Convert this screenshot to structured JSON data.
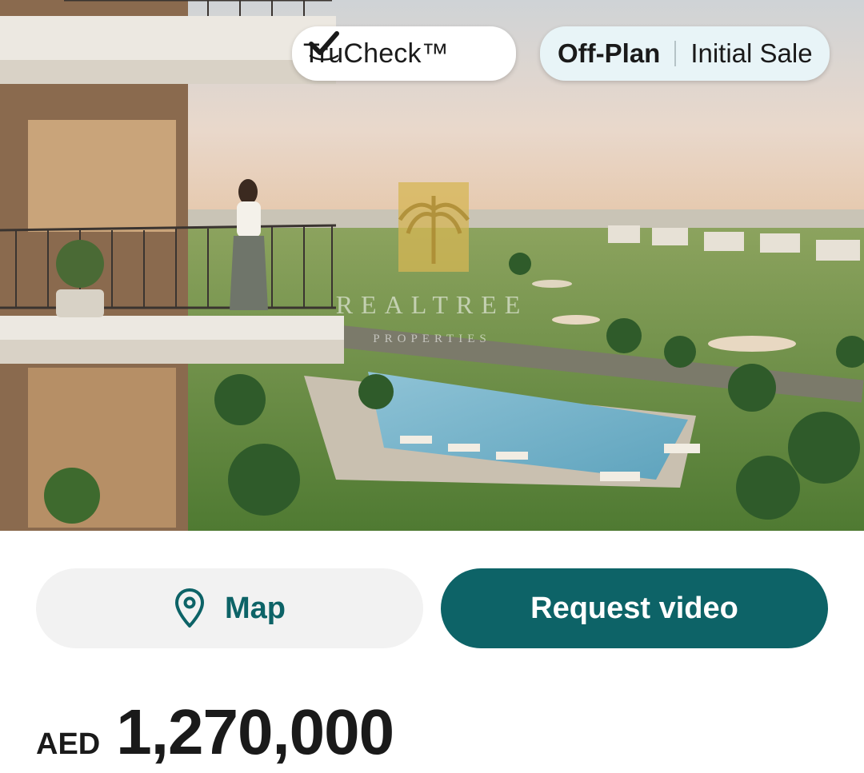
{
  "listing": {
    "image_alt": "Balcony overlooking pool and golf course",
    "watermark": {
      "brand": "REALTREE",
      "tagline": "PROPERTIES"
    },
    "badges": {
      "trucheck": {
        "label": "TruCheck™",
        "icon": "check-badge-icon"
      },
      "completion": {
        "status": "Off-Plan",
        "sale_type": "Initial Sale"
      }
    }
  },
  "actions": {
    "map": {
      "label": "Map",
      "icon": "location-pin-icon"
    },
    "request_video": {
      "label": "Request video"
    }
  },
  "price": {
    "currency": "AED",
    "amount": "1,270,000"
  },
  "colors": {
    "primary": "#0d6367",
    "status_pill_bg": "#e8f4f7",
    "map_button_bg": "#f2f2f2"
  }
}
